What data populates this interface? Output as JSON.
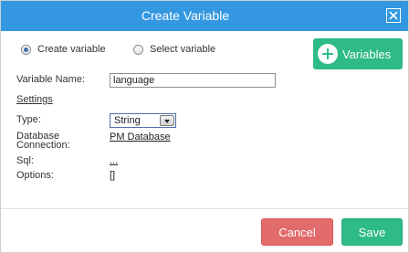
{
  "dialog": {
    "title": "Create Variable",
    "close_icon": "close-icon"
  },
  "mode": {
    "create_label": "Create variable",
    "select_label": "Select variable",
    "selected": "create"
  },
  "variables_button": {
    "label": "Variables",
    "icon": "plus-circle-icon"
  },
  "form": {
    "variable_name_label": "Variable Name:",
    "variable_name_value": "language",
    "settings_label": "Settings",
    "type_label": "Type:",
    "type_value": "String",
    "db_connection_label_line1": "Database",
    "db_connection_label_line2": "Connection:",
    "db_connection_value": "PM Database",
    "sql_label": "Sql:",
    "sql_value": "...",
    "options_label": "Options:",
    "options_value": "[]"
  },
  "footer": {
    "cancel_label": "Cancel",
    "save_label": "Save"
  },
  "colors": {
    "titlebar": "#3397e1",
    "accent_green": "#2ebb86",
    "cancel_red": "#e26b6b"
  }
}
